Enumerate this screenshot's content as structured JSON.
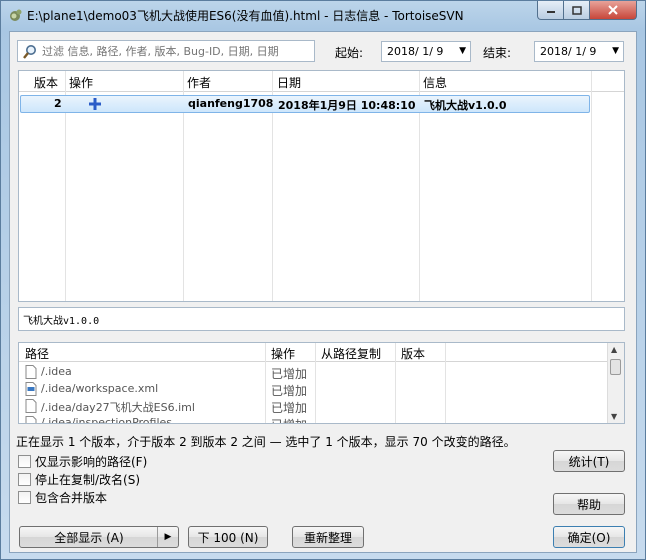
{
  "window": {
    "title": "E:\\plane1\\demo03飞机大战使用ES6(没有血值).html - 日志信息 - TortoiseSVN",
    "minimize_icon": "minimize-icon",
    "maximize_icon": "maximize-icon",
    "close_icon": "close-icon"
  },
  "filter": {
    "placeholder": "过滤 信息, 路径, 作者, 版本, Bug-ID, 日期, 日期",
    "icon": "search-icon"
  },
  "date_range": {
    "from_label": "起始:",
    "from_value": "2018/ 1/ 9",
    "to_label": "结束:",
    "to_value": "2018/ 1/ 9"
  },
  "log_list": {
    "columns": [
      "版本",
      "操作",
      "作者",
      "日期",
      "信息"
    ],
    "rows": [
      {
        "revision": "2",
        "action_icon": "add-icon",
        "author": "qianfeng1708",
        "date": "2018年1月9日 10:48:10",
        "message": "飞机大战v1.0.0"
      }
    ]
  },
  "message_text": "飞机大战v1.0.0",
  "paths": {
    "columns": [
      "路径",
      "操作",
      "从路径复制",
      "版本"
    ],
    "rows": [
      {
        "path": "/.idea",
        "action": "已增加",
        "icon": "file-icon"
      },
      {
        "path": "/.idea/workspace.xml",
        "action": "已增加",
        "icon": "xml-file-icon"
      },
      {
        "path": "/.idea/day27飞机大战ES6.iml",
        "action": "已增加",
        "icon": "file-icon"
      },
      {
        "path": "/.idea/inspectionProfiles",
        "action": "已增加",
        "icon": "file-icon"
      }
    ]
  },
  "status_text": "正在显示 1 个版本，介于版本 2 到版本 2 之间 — 选中了 1 个版本，显示 70 个改变的路径。",
  "options": [
    {
      "label": "仅显示影响的路径(F)",
      "checked": false
    },
    {
      "label": "停止在复制/改名(S)",
      "checked": false
    },
    {
      "label": "包含合并版本",
      "checked": false
    }
  ],
  "buttons": {
    "show_all": "全部显示 (A)",
    "next_100": "下 100 (N)",
    "refresh": "重新整理",
    "statistics": "统计(T)",
    "help": "帮助",
    "ok": "确定(O)"
  }
}
